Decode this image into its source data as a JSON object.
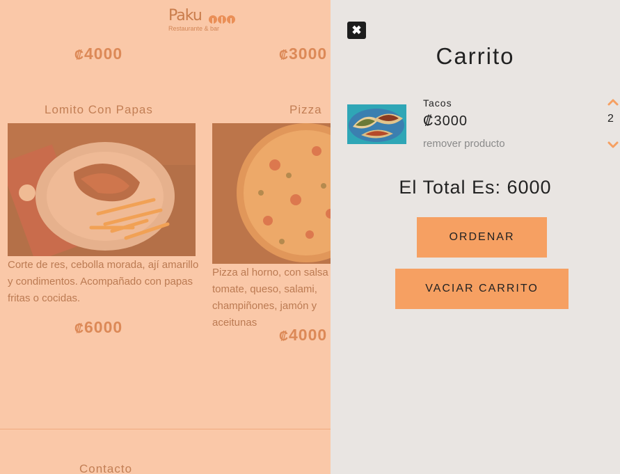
{
  "brand": {
    "name": "Paku",
    "tagline": "Restaurante & bar"
  },
  "menu": {
    "currency_symbol": "₡",
    "top_prices": [
      "4000",
      "3000"
    ],
    "products": [
      {
        "name": "Lomito Con Papas",
        "description": "Corte de res, cebolla morada, ají amarillo y condimentos. Acompañado con papas fritas o cocidas.",
        "price": "6000"
      },
      {
        "name": "Pizza",
        "description": "Pizza al horno, con salsa de tomate, queso, salami, champiñones, jamón y aceitunas",
        "price": "4000"
      }
    ]
  },
  "footer": {
    "contact_label": "Contacto"
  },
  "cart": {
    "close_icon": "✖",
    "title": "Carrito",
    "items": [
      {
        "name": "Tacos",
        "currency_symbol": "₡",
        "price": "3000",
        "remove_label": "remover producto",
        "quantity": "2"
      }
    ],
    "total_label": "El Total Es: 6000",
    "order_label": "ORDENAR",
    "clear_label": "VACIAR CARRITO"
  },
  "colors": {
    "overlay": "#f7a069",
    "drawer_bg": "#e9e5e2",
    "button_bg": "#f6a062",
    "chevron": "#f6a062"
  }
}
